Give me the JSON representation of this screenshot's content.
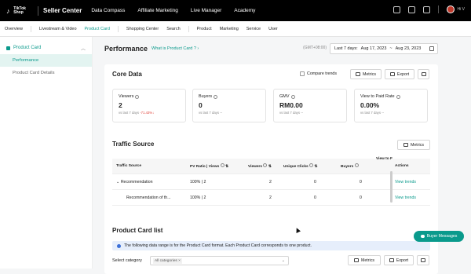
{
  "topbar": {
    "logo_text": "TikTok Shop",
    "title": "Seller Center",
    "nav": [
      "Data Compass",
      "Affiliate Marketing",
      "Live Manager",
      "Academy"
    ],
    "user_label": "Hi V"
  },
  "subnav": {
    "items": [
      "Overview",
      "Livestream & Video",
      "Product Card",
      "Shopping Center",
      "Search",
      "Product",
      "Marketing",
      "Service",
      "User"
    ],
    "active_index": 2
  },
  "sidebar": {
    "group_label": "Product Card",
    "items": [
      "Performance",
      "Product Card Details"
    ],
    "active_index": 0
  },
  "performance": {
    "title": "Performance",
    "help_link": "What is Product Card ?",
    "timezone": "(GMT+08:00)",
    "range_label": "Last 7 days:",
    "start_date": "Aug 17, 2023",
    "end_date": "Aug 23, 2023",
    "range_sep": "~"
  },
  "core_data": {
    "title": "Core Data",
    "compare_label": "Compare trends",
    "metrics_btn": "Metrics",
    "export_btn": "Export",
    "cards": [
      {
        "name": "Viewers",
        "value": "2",
        "cmp_label": "vs last 7 days",
        "cmp_value": "-71.43%"
      },
      {
        "name": "Buyers",
        "value": "0",
        "cmp_label": "vs last 7 days",
        "cmp_value": "--"
      },
      {
        "name": "GMV",
        "value": "RM0.00",
        "cmp_label": "vs last 7 days",
        "cmp_value": "--"
      },
      {
        "name": "View to Paid Rate",
        "value": "0.00%",
        "cmp_label": "vs last 7 days",
        "cmp_value": "--"
      }
    ]
  },
  "traffic_source": {
    "title": "Traffic Source",
    "metrics_btn": "Metrics",
    "headers": [
      "Traffic Source",
      "PV Ratio | Views",
      "Viewers",
      "Unique Clicks",
      "Buyers",
      "View to F",
      "Actions"
    ],
    "rows": [
      {
        "source": "Recommendation",
        "pv": "100% | 2",
        "viewers": "2",
        "clicks": "0",
        "buyers": "0",
        "action": "View trends"
      },
      {
        "source": "Recommendation of th...",
        "pv": "100% | 2",
        "viewers": "2",
        "clicks": "0",
        "buyers": "0",
        "action": "View trends"
      }
    ]
  },
  "product_list": {
    "title": "Product Card list",
    "info": "The following data range is for the Product Card format. Each Product Card corresponds to one product.",
    "select_label": "Select category",
    "select_tag": "All categories",
    "metrics_btn": "Metrics",
    "export_btn": "Export"
  },
  "buyer_messages": "Buyer Messages",
  "colors": {
    "accent": "#0a9a8c",
    "negative": "#e0443c",
    "topbar": "#000000"
  }
}
